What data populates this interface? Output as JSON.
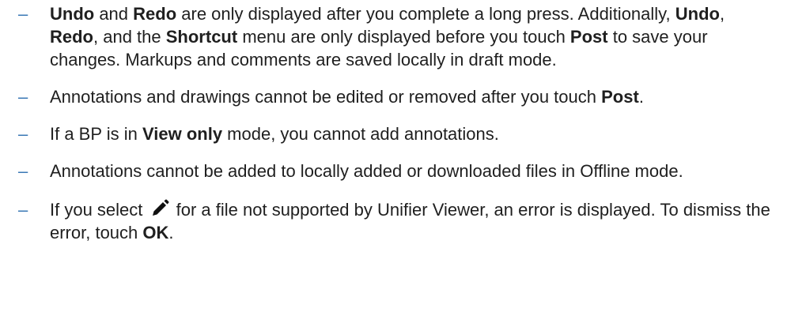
{
  "bullet_glyph": "–",
  "bullet_color": "#3a78b5",
  "text_color": "#1f1f1f",
  "notes": [
    {
      "t1": "Undo",
      "t2": " and ",
      "t3": "Redo",
      "t4": " are only displayed after you complete a long press. Additionally, ",
      "t5": "Undo",
      "t6": ", ",
      "t7": "Redo",
      "t8": ", and the ",
      "t9": "Shortcut",
      "t10": " menu are only displayed before you touch ",
      "t11": "Post",
      "t12": " to save your changes. Markups and comments are saved locally in draft mode."
    },
    {
      "t1": "Annotations and drawings cannot be edited or removed after you touch ",
      "t2": "Post",
      "t3": "."
    },
    {
      "t1": "If a BP is in ",
      "t2": "View only",
      "t3": " mode, you cannot add annotations."
    },
    {
      "t1": "Annotations cannot be added to locally added or downloaded files in Offline mode."
    },
    {
      "t1": "If you select ",
      "icon": "pencil-icon",
      "t2": " for a file not supported by Unifier Viewer, an error is displayed. To dismiss the error, touch ",
      "t3": "OK",
      "t4": "."
    }
  ]
}
